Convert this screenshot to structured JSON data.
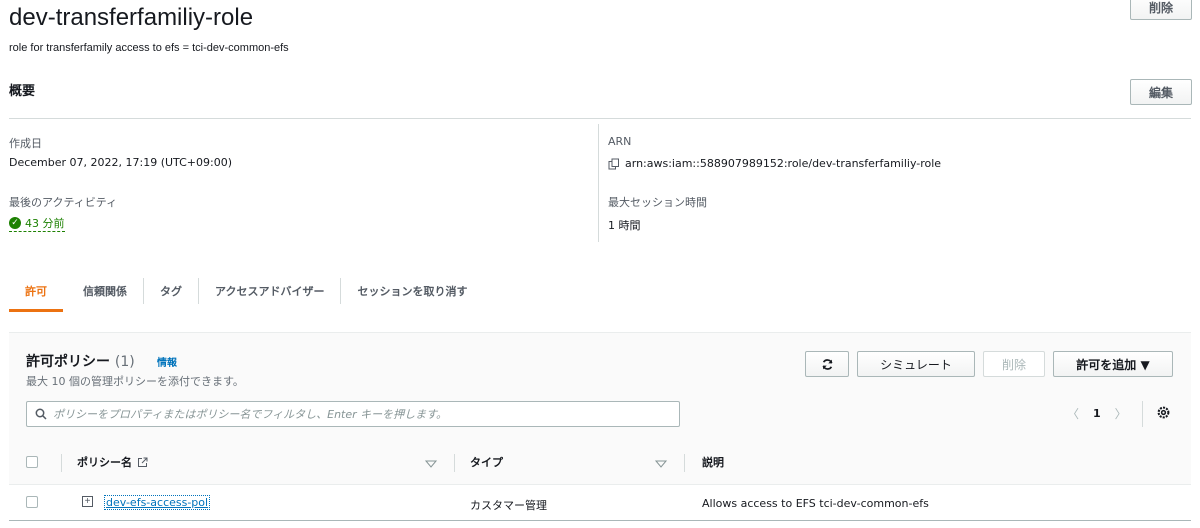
{
  "header": {
    "title": "dev-transferfamiliy-role",
    "description": "role for transferfamily access to efs = tci-dev-common-efs",
    "delete_label": "削除"
  },
  "summary": {
    "title": "概要",
    "edit_label": "編集",
    "created_label": "作成日",
    "created_value": "December 07, 2022, 17:19 (UTC+09:00)",
    "arn_label": "ARN",
    "arn_value": "arn:aws:iam::588907989152:role/dev-transferfamiliy-role",
    "last_activity_label": "最後のアクティビティ",
    "last_activity_value": "43 分前",
    "max_session_label": "最大セッション時間",
    "max_session_value": "1 時間"
  },
  "tabs": [
    {
      "label": "許可",
      "active": true
    },
    {
      "label": "信頼関係",
      "active": false
    },
    {
      "label": "タグ",
      "active": false
    },
    {
      "label": "アクセスアドバイザー",
      "active": false
    },
    {
      "label": "セッションを取り消す",
      "active": false
    }
  ],
  "policies": {
    "title": "許可ポリシー",
    "count": "(1)",
    "info_label": "情報",
    "subtitle": "最大 10 個の管理ポリシーを添付できます。",
    "refresh_icon": "refresh-icon",
    "simulate_label": "シミュレート",
    "delete_label": "削除",
    "add_label": "許可を追加 ▼",
    "search_placeholder": "ポリシーをプロパティまたはポリシー名でフィルタし、Enter キーを押します。",
    "page_number": "1",
    "columns": {
      "name": "ポリシー名",
      "type": "タイプ",
      "description": "説明"
    },
    "rows": [
      {
        "name": "dev-efs-access-pol",
        "type": "カスタマー管理",
        "description": "Allows access to EFS tci-dev-common-efs"
      }
    ]
  },
  "colors": {
    "accent": "#ec7211",
    "link": "#0073bb",
    "success": "#1d8102"
  }
}
